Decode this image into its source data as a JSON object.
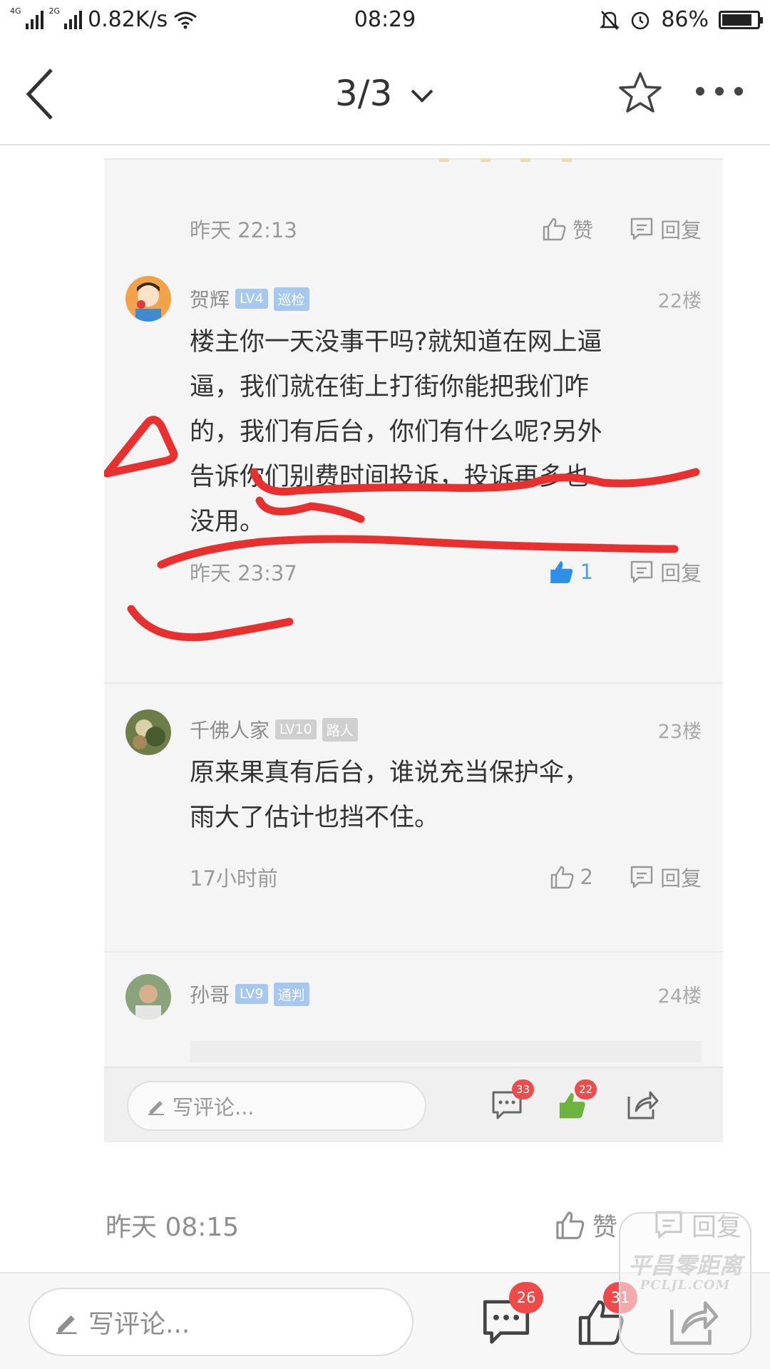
{
  "status_bar": {
    "net_label_1": "4G",
    "net_label_2": "2G",
    "speed": "0.82K/s",
    "time": "08:29",
    "battery": "86%",
    "battery_level": 0.86
  },
  "nav": {
    "title": "3/3"
  },
  "thread": {
    "first_meta": {
      "time": "昨天 22:13",
      "like_label": "赞",
      "reply_label": "回复"
    },
    "posts": [
      {
        "user": "贺辉",
        "level": "LV4",
        "role": "巡检",
        "floor": "22楼",
        "lines": [
          "楼主你一天没事干吗?就知道在网上逼",
          "逼，我们就在街上打街你能把我们咋",
          "的，我们有后台，你们有什么呢?另外",
          "告诉你们别费时间投诉，投诉再多也",
          "没用。"
        ],
        "time": "昨天 23:37",
        "likes": "1",
        "reply_label": "回复"
      },
      {
        "user": "千佛人家",
        "level": "LV10",
        "role": "路人",
        "floor": "23楼",
        "lines": [
          "原来果真有后台，谁说充当保护伞，",
          "雨大了估计也挡不住。"
        ],
        "time": "17小时前",
        "likes": "2",
        "reply_label": "回复"
      },
      {
        "user": "孙哥",
        "level": "LV9",
        "role": "通判",
        "floor": "24楼"
      }
    ],
    "inner_bar": {
      "placeholder": "写评论...",
      "comments": "33",
      "likes": "22"
    }
  },
  "outer_meta": {
    "time": "昨天 08:15",
    "like_label": "赞",
    "reply_label": "回复"
  },
  "bottom_bar": {
    "placeholder": "写评论...",
    "comments": "26",
    "likes": "31"
  },
  "watermark": {
    "line1": "平昌零距离",
    "line2": "PCLJL.COM"
  },
  "colors": {
    "annotation_red": "#e8302e",
    "like_blue": "#2f8fe6",
    "badge_red": "#ee4a4a"
  }
}
